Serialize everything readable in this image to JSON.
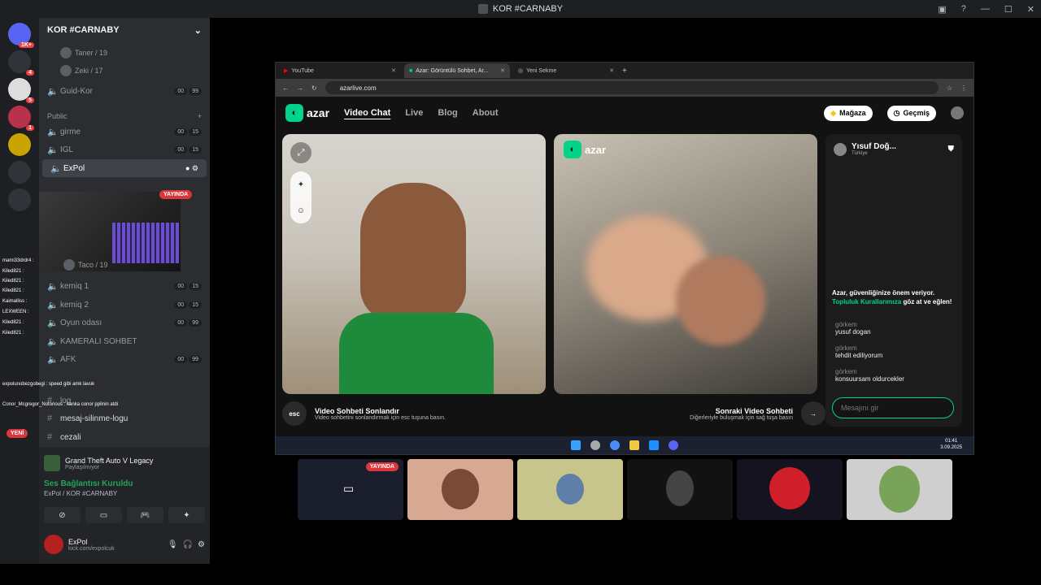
{
  "window": {
    "title": "KOR #CARNABY"
  },
  "server_badges": [
    "1K+",
    "4",
    "5",
    "1"
  ],
  "guild": {
    "name": "KOR #CARNABY"
  },
  "channels": {
    "users_top": [
      "Taner / 19",
      "Zeki / 17"
    ],
    "guid_kor": {
      "name": "Guid-Kor",
      "c1": "00",
      "c2": "99"
    },
    "public_label": "Public",
    "girme": {
      "name": "girme",
      "c1": "00",
      "c2": "15"
    },
    "igl": {
      "name": "IGL",
      "c1": "00",
      "c2": "15"
    },
    "expol": {
      "name": "ExPol"
    },
    "live_label": "YAYINDA",
    "taco": "Taco / 19",
    "kemiq1": {
      "name": "kemiq 1",
      "c1": "00",
      "c2": "15"
    },
    "kemiq2": {
      "name": "kemiq 2",
      "c1": "00",
      "c2": "15"
    },
    "oyun": {
      "name": "Oyun odası",
      "c1": "00",
      "c2": "99"
    },
    "kamerali": {
      "name": "KAMERALI SOHBET"
    },
    "afk": {
      "name": "AFK",
      "c1": "00",
      "c2": "99"
    },
    "log": "log",
    "mesaj": "mesaj-silinme-logu",
    "cezali": "cezali",
    "yeni": "YENİ"
  },
  "chat_overlay": [
    "mami33drdr4 :",
    "Kiled821 :",
    "Kiled821 :",
    "Kiled821 :",
    "Kaimalliss :",
    "LEXWEEN :",
    "Kiled821 :",
    "Kiled821 :",
    "expolunobezgobegi : speed gibi amk lavuk",
    "Conor_Mcgregor_Notorious : kanka conor pplinin atdi"
  ],
  "activity": {
    "game": "Grand Theft Auto V Legacy",
    "sub": "Paylaşılmıyor"
  },
  "voice": {
    "status": "Ses Bağlantısı Kuruldu",
    "where": "ExPol / KOR #CARNABY"
  },
  "me": {
    "name": "ExPol",
    "status": "kick.com/expolcuk"
  },
  "browser": {
    "tabs": [
      {
        "label": "YouTube"
      },
      {
        "label": "Azar: Görüntülü Sohbet, Ar..."
      },
      {
        "label": "Yeni Sekme"
      }
    ],
    "url": "azarlive.com"
  },
  "azar": {
    "logo": "azar",
    "nav": [
      "Video Chat",
      "Live",
      "Blog",
      "About"
    ],
    "shop": "Mağaza",
    "history": "Geçmiş",
    "partner": {
      "name": "Yısuf Doğ...",
      "country": "Türkiye"
    },
    "safety": "Azar, güvenliğinize önem veriyor.",
    "safety_link": "Topluluk Kurallarımıza",
    "safety_tail": "göz at ve eğlen!",
    "messages": [
      {
        "user": "görkem",
        "text": "yusuf dogan"
      },
      {
        "user": "görkem",
        "text": "tehdit ediliyorum"
      },
      {
        "user": "görkem",
        "text": "konsuursam oldurcekler"
      }
    ],
    "input_placeholder": "Mesajını gir",
    "end_title": "Video Sohbeti Sonlandır",
    "end_sub": "Video sohbetini sonlandırmak için esc tuşuna basın.",
    "esc": "esc",
    "next_title": "Sonraki Video Sohbeti",
    "next_sub": "Diğerleriyle buluşmak için sağ tuşa basın"
  },
  "taskbar": {
    "time": "01:41",
    "date": "3.09.2025"
  },
  "thumbs_live": "YAYINDA"
}
